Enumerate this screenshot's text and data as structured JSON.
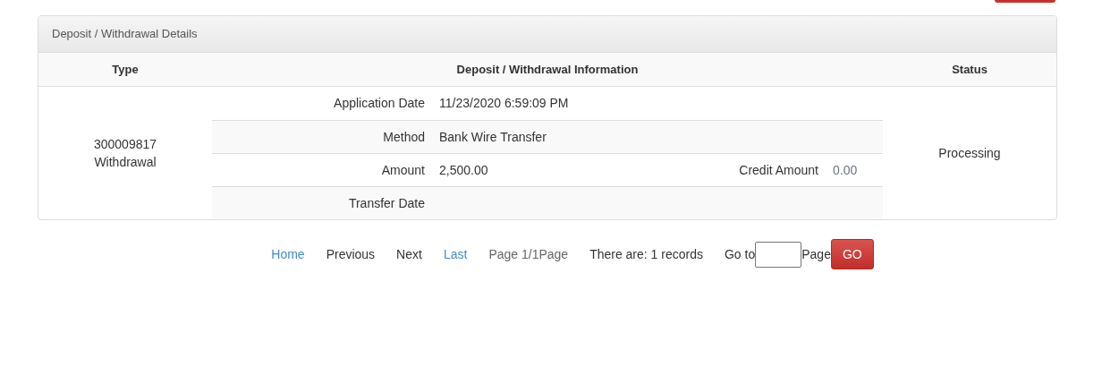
{
  "panel": {
    "title": "Deposit / Withdrawal Details",
    "columns": [
      "Type",
      "Deposit / Withdrawal Information",
      "Status"
    ],
    "record": {
      "number": "300009817",
      "type": "Withdrawal",
      "status": "Processing",
      "details": [
        {
          "label": "Application Date",
          "value": "11/23/2020 6:59:09 PM"
        },
        {
          "label": "Method",
          "value": "Bank Wire Transfer"
        },
        {
          "label": "Amount",
          "value": "2,500.00",
          "extra_label": "Credit Amount",
          "extra_value": "0.00"
        },
        {
          "label": "Transfer Date"
        }
      ]
    }
  },
  "pagination": {
    "items": [
      {
        "kind": "link",
        "text": "Home"
      },
      {
        "kind": "text",
        "text": "Previous"
      },
      {
        "kind": "text",
        "text": "Next"
      },
      {
        "kind": "link",
        "text": "Last"
      },
      {
        "kind": "info",
        "text": "Page 1/1Page"
      },
      {
        "kind": "text",
        "text": "There are: 1 records"
      }
    ],
    "goto_label": "Go to",
    "page_label": "Page",
    "go_button": "GO"
  }
}
